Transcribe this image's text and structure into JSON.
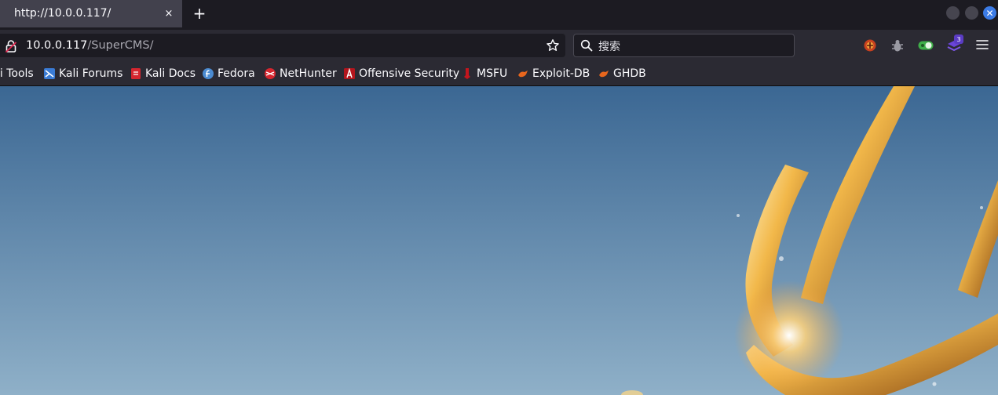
{
  "browser": {
    "tab": {
      "title": "http://10.0.0.117/",
      "close_glyph": "×"
    },
    "new_tab_glyph": "+",
    "window_controls": {
      "close_glyph": "✕"
    }
  },
  "urlbar": {
    "host": "10.0.0.117",
    "path": "/SuperCMS/"
  },
  "searchbar": {
    "placeholder": "搜索"
  },
  "extensions": {
    "badge_count": "3"
  },
  "bookmarks": [
    {
      "label": "li Tools",
      "icon": "kali-tools-icon"
    },
    {
      "label": "Kali Forums",
      "icon": "kali-forums-icon"
    },
    {
      "label": "Kali Docs",
      "icon": "kali-docs-icon"
    },
    {
      "label": "Fedora",
      "icon": "fedora-icon"
    },
    {
      "label": "NetHunter",
      "icon": "nethunter-icon"
    },
    {
      "label": "Offensive Security",
      "icon": "offsec-icon"
    },
    {
      "label": "MSFU",
      "icon": "msfu-icon"
    },
    {
      "label": "Exploit-DB",
      "icon": "exploit-db-icon"
    },
    {
      "label": "GHDB",
      "icon": "ghdb-icon"
    }
  ],
  "colors": {
    "chrome_dark": "#1c1b22",
    "toolbar": "#2b2a33",
    "tab_active": "#42414d",
    "accent_close": "#3b7be6",
    "sky": "#5582ab",
    "trident_gold": "#e8a53a"
  }
}
